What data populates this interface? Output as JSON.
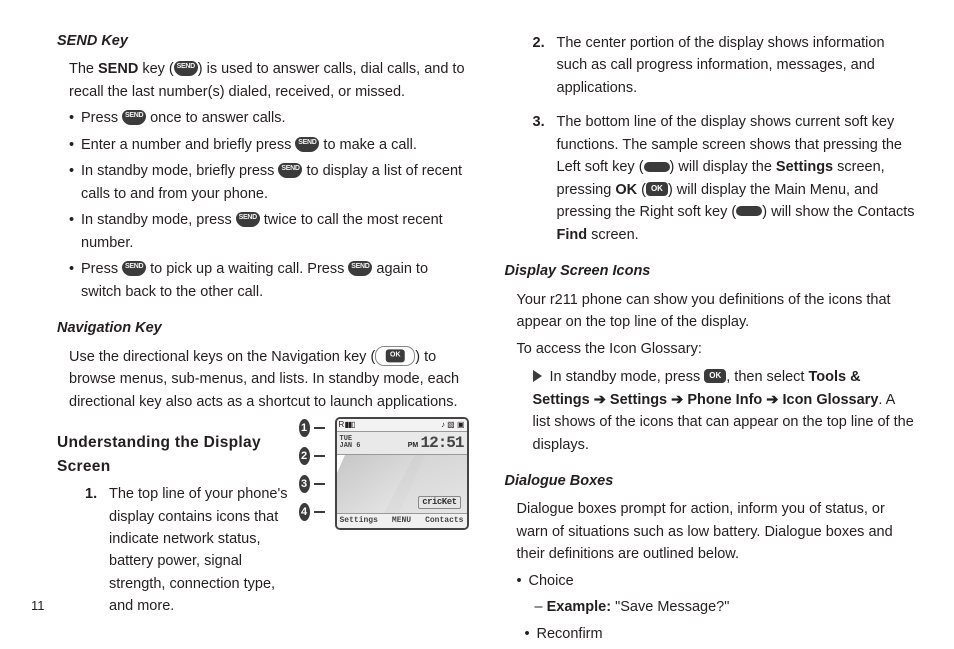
{
  "page_number": "11",
  "left": {
    "send_key": {
      "heading": "SEND Key",
      "intro_a": "The ",
      "intro_b_bold": "SEND",
      "intro_c": " key (",
      "intro_d": ") is used to answer calls, dial calls, and to recall the last number(s) dialed, received, or missed.",
      "bul1_a": "Press ",
      "bul1_b": " once to answer calls.",
      "bul2_a": "Enter a number and briefly press ",
      "bul2_b": " to make a call.",
      "bul3_a": "In standby mode, briefly press ",
      "bul3_b": " to display a list of recent calls to and from your phone.",
      "bul4_a": "In standby mode, press ",
      "bul4_b": " twice to call the most recent number.",
      "bul5_a": "Press ",
      "bul5_b": " to pick up a waiting call. Press ",
      "bul5_c": " again to switch back to the other call."
    },
    "nav_key": {
      "heading": "Navigation Key",
      "p_a": "Use the directional keys on the Navigation key (",
      "p_b": ") to browse menus, sub-menus, and lists. In standby mode, each directional key also acts as a shortcut to launch applications."
    },
    "understand": {
      "heading": "Understanding the Display Screen",
      "step1": "The top line of your phone's display contains icons that indicate network status, battery power, signal strength, connection type, and more."
    },
    "phone": {
      "date_top": "TUE",
      "date_bot": "JAN 6",
      "pm": "PM",
      "clock": "12:51",
      "brand": "cricKet",
      "soft_l": "Settings",
      "soft_c": "MENU",
      "soft_r": "Contacts"
    }
  },
  "right": {
    "step2": "The center portion of the display shows information such as call progress information, messages, and applications.",
    "step3_a": "The bottom line of the display shows current soft key functions. The sample screen shows that pressing the Left soft key (",
    "step3_b": ") will display the ",
    "step3_settings": "Settings",
    "step3_c": " screen, pressing ",
    "step3_ok": "OK",
    "step3_d": " (",
    "step3_e": ") will display the Main Menu, and pressing the Right soft key (",
    "step3_f": ") will show the Contacts ",
    "step3_find": "Find",
    "step3_g": " screen.",
    "icons": {
      "heading": "Display Screen Icons",
      "p1": "Your r211 phone can show you definitions of the icons that appear on the top line of the display.",
      "p2": "To access the Icon Glossary:",
      "step_a": "In standby mode, press ",
      "step_b": ", then select ",
      "tools": "Tools & Settings",
      "arrow": " ➔ ",
      "settings": "Settings",
      "phoneinfo": "Phone Info",
      "iconglos": "Icon Glossary",
      "step_c": ". A list shows of the icons that can appear on the top line of the displays."
    },
    "dialogue": {
      "heading": "Dialogue Boxes",
      "p1": "Dialogue boxes prompt for action, inform you of status, or warn of situations such as low battery. Dialogue boxes and their definitions are outlined below.",
      "b1": "Choice",
      "ex_label": "Example:",
      "ex_text": " \"Save Message?\"",
      "b2": "Reconfirm"
    }
  },
  "callouts": [
    "1",
    "2",
    "3",
    "4"
  ],
  "key_label": "SEND"
}
